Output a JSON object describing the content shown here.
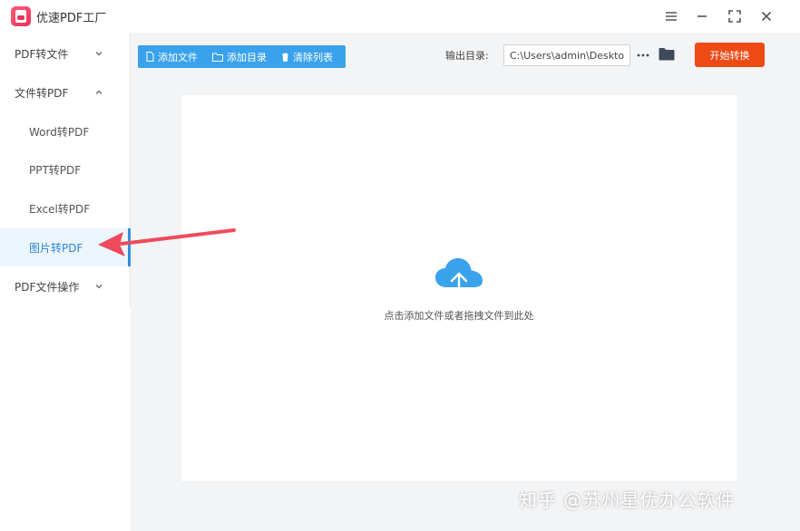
{
  "app": {
    "title": "优速PDF工厂",
    "icon": "app-logo-icon"
  },
  "window_controls": {
    "menu_icon": "menu-icon",
    "minimize_icon": "minimize-icon",
    "maximize_icon": "maximize-icon",
    "close_icon": "close-icon"
  },
  "sidebar": {
    "groups": [
      {
        "label": "PDF转文件",
        "expanded": false
      },
      {
        "label": "文件转PDF",
        "expanded": true,
        "items": [
          {
            "label": "Word转PDF",
            "active": false
          },
          {
            "label": "PPT转PDF",
            "active": false
          },
          {
            "label": "Excel转PDF",
            "active": false
          },
          {
            "label": "图片转PDF",
            "active": true
          }
        ]
      },
      {
        "label": "PDF文件操作",
        "expanded": false
      }
    ]
  },
  "toolbar": {
    "add_file": "添加文件",
    "add_folder": "添加目录",
    "clear_list": "清除列表",
    "output_label": "输出目录:",
    "output_path": "C:\\Users\\admin\\Desktop",
    "start_button": "开始转换"
  },
  "drop_zone": {
    "hint": "点击添加文件或者拖拽文件到此处",
    "icon": "cloud-upload-icon"
  },
  "watermark": "知乎 @苏州星优办公软件",
  "colors": {
    "accent": "#3aa2ec",
    "start": "#ee4a16",
    "active_text": "#2c86d8",
    "arrow": "#ee4b5c"
  }
}
